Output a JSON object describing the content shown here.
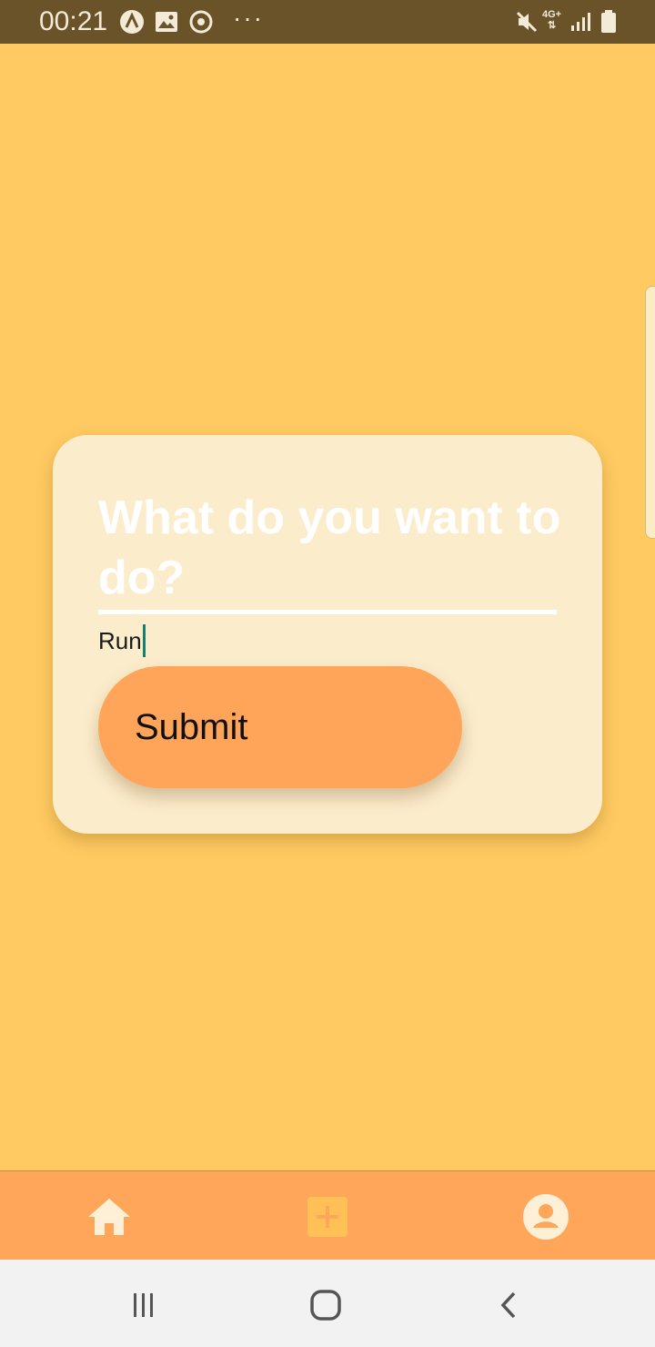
{
  "status_bar": {
    "time": "00:21",
    "dots": "···",
    "network_label": "4G+",
    "icons": [
      "app-a-icon",
      "image-icon",
      "sync-icon",
      "mute-icon",
      "data-arrows-icon",
      "signal-icon",
      "battery-icon"
    ]
  },
  "card": {
    "title": "What do you want to do?",
    "input_value": "Run",
    "submit_label": "Submit"
  },
  "bottom_nav": {
    "items": [
      "home-icon",
      "add-icon",
      "account-icon"
    ]
  },
  "system_nav": {
    "items": [
      "recents-icon",
      "home-circle-icon",
      "back-icon"
    ]
  },
  "colors": {
    "background": "#ffca62",
    "card": "#fbeccb",
    "accent": "#ffa55a",
    "status_bar": "#6a5229",
    "caret": "#16806f"
  }
}
